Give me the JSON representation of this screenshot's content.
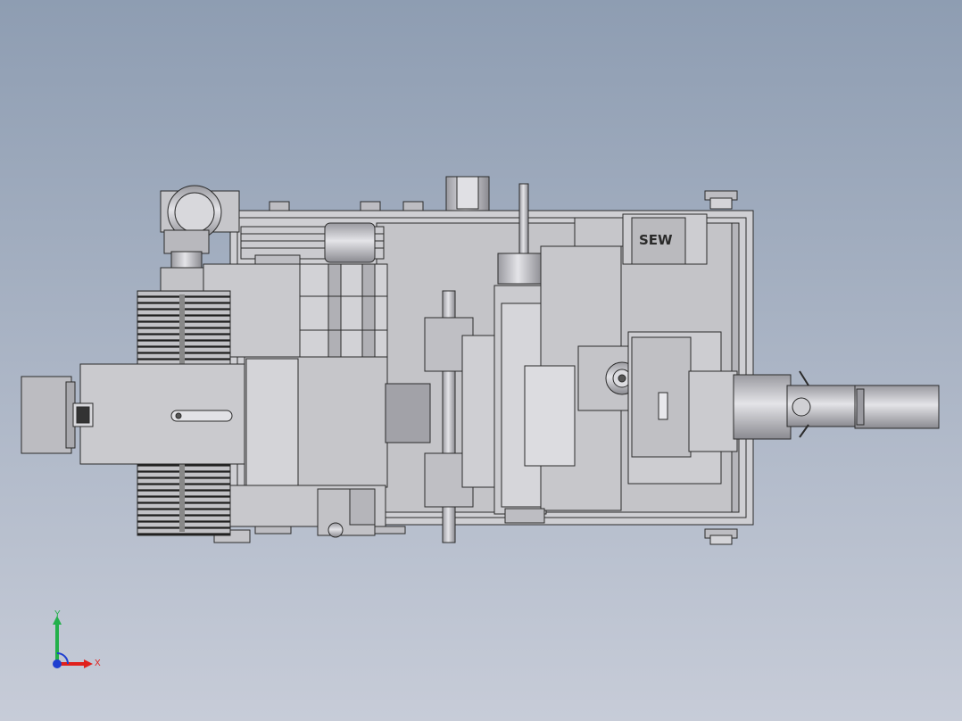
{
  "viewport": {
    "background_top": "#8e9db2",
    "background_bottom": "#c7ccd8",
    "part_fill": "#c9c9cd",
    "part_fill_dark": "#a9a9ae",
    "part_fill_light": "#dcdce0",
    "edge_color": "#2b2b2b"
  },
  "assembly": {
    "motor_brand_label": "SEW"
  },
  "triad": {
    "x_label": "X",
    "y_label": "Y",
    "x_color": "#e0201c",
    "y_color": "#22b04a",
    "z_color": "#1f3fd0"
  }
}
